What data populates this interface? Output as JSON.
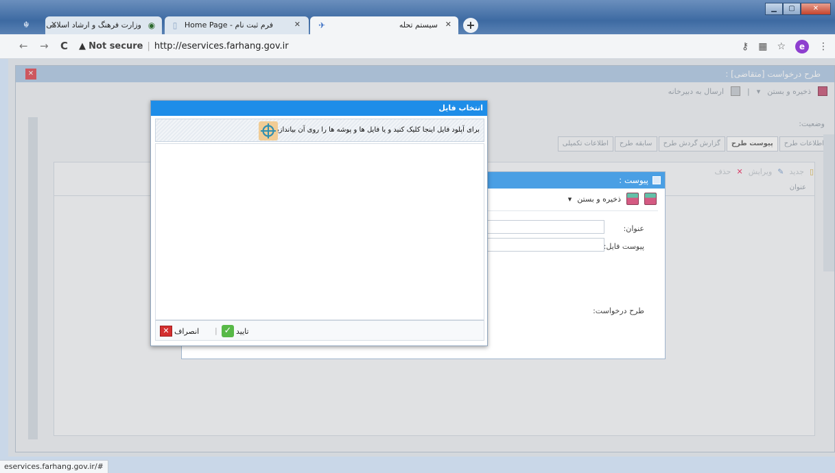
{
  "browser": {
    "tabs": [
      {
        "title": "وزارت فرهنگ و ارشاد اسلامی",
        "favicon": "emblem-icon",
        "active": false
      },
      {
        "title": "فرم ثبت نام - Home Page",
        "favicon": "page-icon",
        "active": false
      },
      {
        "title": "سیستم تحله",
        "favicon": "app-logo-icon",
        "active": true
      }
    ],
    "close_glyph": "✕",
    "new_tab_glyph": "+",
    "address": {
      "warning": "Not secure",
      "url": "http://eservices.farhang.gov.ir"
    },
    "avatar_letter": "e",
    "status_url": "eservices.farhang.gov.ir/#"
  },
  "app": {
    "window_title": "طرح درخواست [متقاضی] :",
    "toolbar": {
      "save_close": "ذخیره و بستن",
      "send_secretariat": "ارسال به دبیرخانه"
    },
    "status_label": "وضعیت:",
    "tabs": [
      "اطلاعات طرح",
      "پیوست طرح",
      "گزارش گردش طرح",
      "سابقه طرح",
      "اطلاعات تکمیلی"
    ],
    "selected_tab": "پیوست طرح",
    "grid_tools": {
      "new": "جدید",
      "edit": "ویرایش",
      "delete": "حذف"
    },
    "grid_column": "عنوان"
  },
  "attachment_dialog": {
    "title": "پیوست :",
    "save_close": "ذخیره و بستن",
    "fields": {
      "title_label": "عنوان:",
      "file_label": "پیوست فایل:",
      "request_label": "طرح درخواست:"
    }
  },
  "file_dialog": {
    "title": "انتخاب فایل",
    "drop_message": "برای آپلود فایل اینجا کلیک کنید و یا فایل ها و پوشه ها را روی آن بیاندازید.",
    "ok_label": "تایید",
    "cancel_label": "انصراف"
  },
  "colors": {
    "dialog_header": "#1e8de8",
    "attach_header": "#4a9fe4",
    "ok_green": "#58b947",
    "cancel_red": "#d32f2f"
  }
}
